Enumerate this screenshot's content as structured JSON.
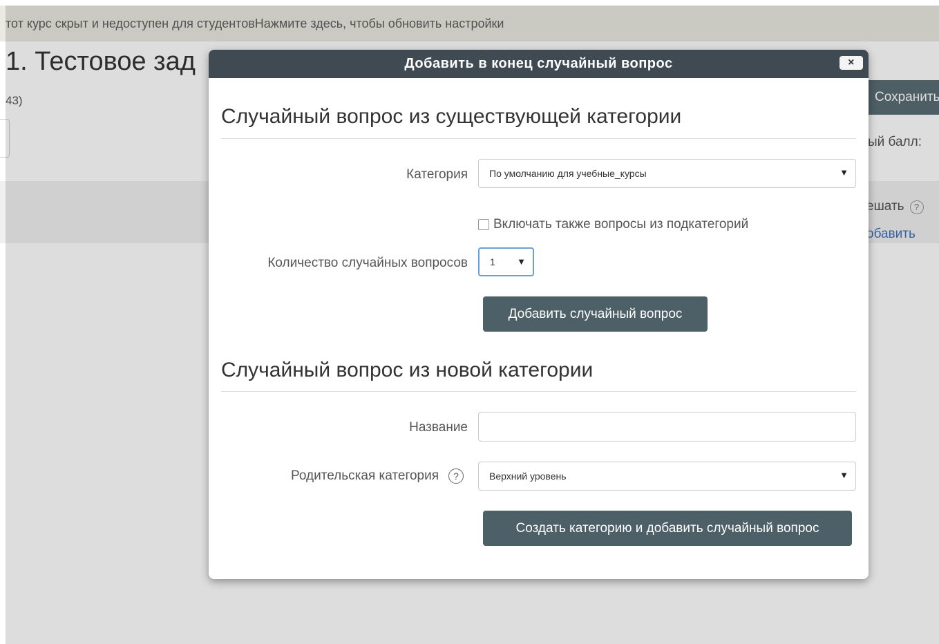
{
  "background": {
    "notice": "тот курс скрыт и недоступен для студентовНажмите здесь, чтобы обновить настройки",
    "page_title": "1. Тестовое зад",
    "page_subtitle": "43)",
    "save_button": "Сохранить",
    "max_grade_label": "ый балл: ",
    "shuffle_label": "ешать",
    "add_link": "обавить"
  },
  "modal": {
    "title": "Добавить в конец случайный вопрос",
    "close_symbol": "×",
    "existing": {
      "heading": "Случайный вопрос из существующей категории",
      "category_label": "Категория",
      "category_value": "По умолчанию для учебные_курсы",
      "include_subcategories_label": "Включать также вопросы из подкатегорий",
      "count_label": "Количество случайных вопросов",
      "count_value": "1",
      "add_button": "Добавить случайный вопрос"
    },
    "new": {
      "heading": "Случайный вопрос из новой категории",
      "name_label": "Название",
      "name_value": "",
      "parent_label": "Родительская категория",
      "parent_value": "Верхний уровень",
      "create_button": "Создать категорию и добавить случайный вопрос"
    }
  },
  "icons": {
    "dropdown": "▼",
    "help": "?"
  }
}
